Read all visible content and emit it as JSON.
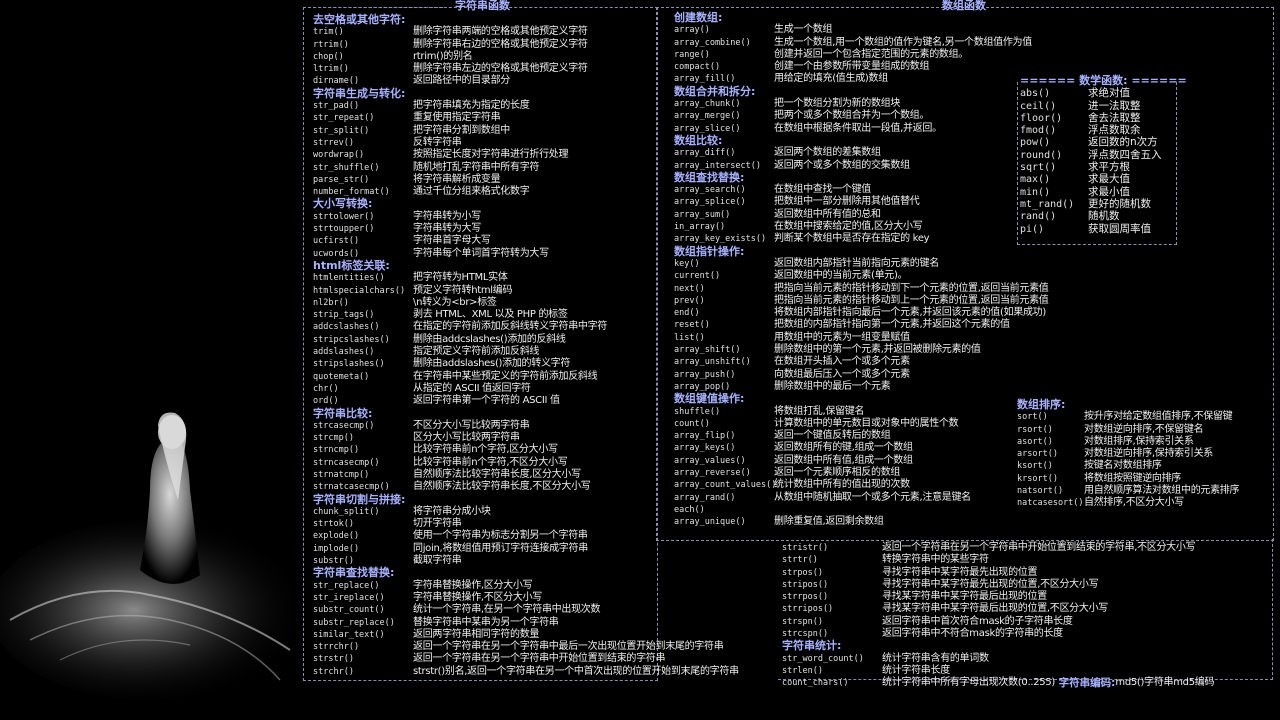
{
  "string_panel": {
    "title": "字符串函数",
    "sections": [
      {
        "heading": "去空格或其他字符:",
        "rows": [
          [
            "trim()",
            "删除字符串两端的空格或其他预定义字符"
          ],
          [
            "rtrim()",
            "删除字符串右边的空格或其他预定义字符"
          ],
          [
            "chop()",
            "rtrim()的别名"
          ],
          [
            "ltrim()",
            "删除字符串左边的空格或其他预定义字符"
          ],
          [
            "dirname()",
            "返回路径中的目录部分"
          ]
        ]
      },
      {
        "heading": "字符串生成与转化:",
        "rows": [
          [
            "str_pad()",
            "把字符串填充为指定的长度"
          ],
          [
            "str_repeat()",
            "重复使用指定字符串"
          ],
          [
            "str_split()",
            "把字符串分割到数组中"
          ],
          [
            "strrev()",
            "反转字符串"
          ],
          [
            "wordwrap()",
            "按照指定长度对字符串进行折行处理"
          ],
          [
            "str_shuffle()",
            "随机地打乱字符串中所有字符"
          ],
          [
            "parse_str()",
            "将字符串解析成变量"
          ],
          [
            "number_format()",
            "通过千位分组来格式化数字"
          ]
        ]
      },
      {
        "heading": "大小写转换:",
        "rows": [
          [
            "strtolower()",
            "字符串转为小写"
          ],
          [
            "strtoupper()",
            "字符串转为大写"
          ],
          [
            "ucfirst()",
            "字符串首字母大写"
          ],
          [
            "ucwords()",
            "字符串每个单词首字符转为大写"
          ]
        ]
      },
      {
        "heading": "html标签关联:",
        "rows": [
          [
            "htmlentities()",
            "把字符转为HTML实体"
          ],
          [
            "htmlspecialchars()",
            "预定义字符转html编码"
          ],
          [
            "nl2br()",
            "\\n转义为<br>标签"
          ],
          [
            "strip_tags()",
            "剥去 HTML、XML 以及 PHP 的标签"
          ],
          [
            "addcslashes()",
            "在指定的字符前添加反斜线转义字符串中字符"
          ],
          [
            "stripcslashes()",
            "删除由addcslashes()添加的反斜线"
          ],
          [
            "addslashes()",
            "指定预定义字符前添加反斜线"
          ],
          [
            "stripslashes()",
            "删除由addslashes()添加的转义字符"
          ],
          [
            "quotemeta()",
            "在字符串中某些预定义的字符前添加反斜线"
          ],
          [
            "chr()",
            "从指定的 ASCII 值返回字符"
          ],
          [
            "ord()",
            "返回字符串第一个字符的 ASCII 值"
          ]
        ]
      },
      {
        "heading": "字符串比较:",
        "rows": [
          [
            "strcasecmp()",
            "不区分大小写比较两字符串"
          ],
          [
            "strcmp()",
            "区分大小写比较两字符串"
          ],
          [
            "strncmp()",
            "比较字符串前n个字符,区分大小写"
          ],
          [
            "strncasecmp()",
            "比较字符串前n个字符,不区分大小写"
          ],
          [
            "strnatcmp()",
            "自然顺序法比较字符串长度,区分大小写"
          ],
          [
            "strnatcasecmp()",
            "自然顺序法比较字符串长度,不区分大小写"
          ]
        ]
      },
      {
        "heading": "字符串切割与拼接:",
        "rows": [
          [
            "chunk_split()",
            "将字符串分成小块"
          ],
          [
            "strtok()",
            "切开字符串"
          ],
          [
            "explode()",
            "使用一个字符串为标志分割另一个字符串"
          ],
          [
            "implode()",
            "同join,将数组值用预订字符连接成字符串"
          ],
          [
            "substr()",
            "截取字符串"
          ]
        ]
      },
      {
        "heading": "字符串查找替换:",
        "rows": [
          [
            "str_replace()",
            "字符串替换操作,区分大小写"
          ],
          [
            "str_ireplace()",
            "字符串替换操作,不区分大小写"
          ],
          [
            "substr_count()",
            "统计一个字符串,在另一个字符串中出现次数"
          ],
          [
            "substr_replace()",
            "替换字符串中某串为另一个字符串"
          ],
          [
            "similar_text()",
            "返回两字符串相同字符的数量"
          ],
          [
            "strrchr()",
            "返回一个字符串在另一个字符串中最后一次出现位置开始到末尾的字符串"
          ],
          [
            "strstr()",
            "返回一个字符串在另一个字符串中开始位置到结束的字符串"
          ],
          [
            "strchr()",
            "strstr()别名,返回一个字符串在另一个中首次出现的位置开始到末尾的字符串"
          ]
        ]
      }
    ],
    "continued": [
      [
        "stristr()",
        "返回一个字符串在另一个字符串中开始位置到结束的字符串,不区分大小写"
      ],
      [
        "strtr()",
        "转换字符串中的某些字符"
      ],
      [
        "strpos()",
        "寻找字符串中某字符最先出现的位置"
      ],
      [
        "stripos()",
        "寻找字符串中某字符最先出现的位置,不区分大小写"
      ],
      [
        "strrpos()",
        "寻找某字符串中某字符最后出现的位置"
      ],
      [
        "strripos()",
        "寻找某字符串中某字符最后出现的位置,不区分大小写"
      ],
      [
        "strspn()",
        "返回字符串中首次符合mask的子字符串长度"
      ],
      [
        "strcspn()",
        "返回字符串中不符合mask的字符串的长度"
      ]
    ],
    "count_heading": "字符串统计:",
    "count_rows": [
      [
        "str_word_count()",
        "统计字符串含有的单词数"
      ],
      [
        "strlen()",
        "统计字符串长度"
      ],
      [
        "count_chars()",
        "统计字符串中所有字母出现次数(0..255)"
      ]
    ],
    "encode_heading": "字符串编码:",
    "encode_text": "md5()字符串md5编码"
  },
  "array_panel": {
    "title": "数组函数",
    "sections": [
      {
        "heading": "创建数组:",
        "rows": [
          [
            "array()",
            "生成一个数组"
          ],
          [
            "array_combine()",
            "生成一个数组,用一个数组的值作为键名,另一个数组值作为值"
          ],
          [
            "range()",
            "创建并返回一个包含指定范围的元素的数组。"
          ],
          [
            "compact()",
            "创建一个由参数所带变量组成的数组"
          ],
          [
            "array_fill()",
            "用给定的填充(值生成)数组"
          ]
        ]
      },
      {
        "heading": "数组合并和拆分:",
        "rows": [
          [
            "array_chunk()",
            "把一个数组分割为新的数组块"
          ],
          [
            "array_merge()",
            "把两个或多个数组合并为一个数组。"
          ],
          [
            "array_slice()",
            "在数组中根据条件取出一段值,并返回。"
          ]
        ]
      },
      {
        "heading": "数组比较:",
        "rows": [
          [
            "array_diff()",
            "返回两个数组的差集数组"
          ],
          [
            "array_intersect()",
            "返回两个或多个数组的交集数组"
          ]
        ]
      },
      {
        "heading": "数组查找替换:",
        "rows": [
          [
            "array_search()",
            "在数组中查找一个键值"
          ],
          [
            "array_splice()",
            "把数组中一部分删除用其他值替代"
          ],
          [
            "array_sum()",
            "返回数组中所有值的总和"
          ],
          [
            "in_array()",
            "在数组中搜索给定的值,区分大小写"
          ],
          [
            "array_key_exists()",
            "判断某个数组中是否存在指定的 key"
          ]
        ]
      },
      {
        "heading": "数组指针操作:",
        "rows": [
          [
            "key()",
            "返回数组内部指针当前指向元素的键名"
          ],
          [
            "current()",
            "返回数组中的当前元素(单元)。"
          ],
          [
            "next()",
            "把指向当前元素的指针移动到下一个元素的位置,返回当前元素值"
          ],
          [
            "prev()",
            "把指向当前元素的指针移动到上一个元素的位置,返回当前元素值"
          ],
          [
            "end()",
            "将数组内部指针指向最后一个元素,并返回该元素的值(如果成功)"
          ],
          [
            "reset()",
            "把数组的内部指针指向第一个元素,并返回这个元素的值"
          ],
          [
            "list()",
            "用数组中的元素为一组变量赋值"
          ],
          [
            "array_shift()",
            "删除数组中的第一个元素,并返回被删除元素的值"
          ],
          [
            "array_unshift()",
            "在数组开头插入一个或多个元素"
          ],
          [
            "array_push()",
            "向数组最后压入一个或多个元素"
          ],
          [
            "array_pop()",
            "删除数组中的最后一个元素"
          ]
        ]
      },
      {
        "heading": "数组键值操作:",
        "rows": [
          [
            "shuffle()",
            "将数组打乱,保留键名"
          ],
          [
            "count()",
            "计算数组中的单元数目或对象中的属性个数"
          ],
          [
            "array_flip()",
            "返回一个键值反转后的数组"
          ],
          [
            "array_keys()",
            "返回数组所有的键,组成一个数组"
          ],
          [
            "array_values()",
            "返回数组中所有值,组成一个数组"
          ],
          [
            "array_reverse()",
            "返回一个元素顺序相反的数组"
          ],
          [
            "array_count_values()",
            "统计数组中所有的值出现的次数"
          ],
          [
            "array_rand()",
            "从数组中随机抽取一个或多个元素,注意是键名"
          ],
          [
            "each()",
            ""
          ],
          [
            "array_unique()",
            "删除重复值,返回剩余数组"
          ]
        ]
      }
    ]
  },
  "math_panel": {
    "title": "======  数学函数: ======",
    "rows": [
      [
        "abs()",
        "求绝对值"
      ],
      [
        "ceil()",
        "进一法取整"
      ],
      [
        "floor()",
        "舍去法取整"
      ],
      [
        "fmod()",
        "浮点数取余"
      ],
      [
        "pow()",
        "返回数的n次方"
      ],
      [
        "round()",
        "浮点数四舍五入"
      ],
      [
        "sqrt()",
        "求平方根"
      ],
      [
        "max()",
        "求最大值"
      ],
      [
        "min()",
        "求最小值"
      ],
      [
        "mt_rand()",
        "更好的随机数"
      ],
      [
        "rand()",
        "随机数"
      ],
      [
        "pi()",
        "获取圆周率值"
      ]
    ]
  },
  "sort_panel": {
    "heading": "数组排序:",
    "rows": [
      [
        "sort()",
        "按升序对给定数组值排序,不保留键"
      ],
      [
        "rsort()",
        "对数组逆向排序,不保留键名"
      ],
      [
        "asort()",
        "对数组排序,保持索引关系"
      ],
      [
        "arsort()",
        "对数组逆向排序,保持索引关系"
      ],
      [
        "ksort()",
        "按键名对数组排序"
      ],
      [
        "krsort()",
        "将数组按照键逆向排序"
      ],
      [
        "natsort()",
        "用自然顺序算法对数组中的元素排序"
      ],
      [
        "natcasesort()",
        "自然排序,不区分大小写"
      ]
    ]
  },
  "colors": {
    "background": "#000000",
    "heading": "#a8b2ff",
    "border": "#8a8fb0",
    "text": "#f0f0f0"
  }
}
